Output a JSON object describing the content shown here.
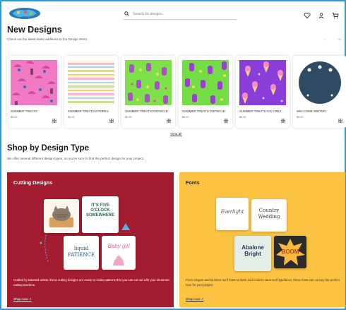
{
  "header": {
    "logo_text": "SupplyMe",
    "search_placeholder": "Search for designs",
    "icons": [
      "heart-icon",
      "user-icon",
      "cart-icon"
    ]
  },
  "new_designs": {
    "title": "New Designs",
    "subtitle": "Check out the latest latest additions to the Design Store",
    "arrows": [
      "←",
      "→"
    ],
    "products": [
      {
        "name": "SUMMER TREATS",
        "price": "$0.00"
      },
      {
        "name": "SUMMER TREATS STRIPES",
        "price": "$0.00"
      },
      {
        "name": "SUMMER TREATS POPSICLE",
        "price": "$0.00"
      },
      {
        "name": "SUMMER TREATS POPSICLE",
        "price": "$0.00"
      },
      {
        "name": "SUMMER TREATS ICE CREA",
        "price": "$0.00"
      },
      {
        "name": "WELCOME WINTER",
        "price": "$0.00"
      }
    ],
    "view_all": "View all"
  },
  "shop_by_type": {
    "title": "Shop by Design Type",
    "subtitle": "We offer several different design types, so you're sure to find the perfect design for your project.",
    "panels": [
      {
        "title": "Cutting Designs",
        "description": "Crafted by talented artists, these cutting designs are ready-to-make patterns that you can cut out with your electronic cutting machine.",
        "cta": "Shop now ↗",
        "tile_texts": [
          "IT'S FIVE O'CLOCK SOMEWHERE",
          "liquid PATIENCE",
          "Baby girl"
        ]
      },
      {
        "title": "Fonts",
        "description": "From elegant and timeless serif fonts to sleek and modern sans-serif typefaces, these fonts can convey the perfect tone for your project.",
        "cta": "Shop now ↗",
        "tile_texts": [
          "Everlight",
          "Country Wedding",
          "Abalone Bright",
          "BOOM"
        ]
      }
    ]
  },
  "colors": {
    "frame_border": "#1f9de0",
    "panel_red": "#a31c2f",
    "panel_yellow": "#fcc342"
  }
}
